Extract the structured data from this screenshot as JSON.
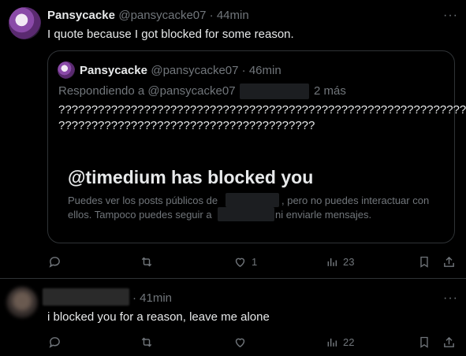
{
  "main_tweet": {
    "display_name": "Pansycacke",
    "handle_time": "@pansycacke07 · 44min",
    "text": "I quote because I got blocked for some reason.",
    "quote": {
      "display_name": "Pansycacke",
      "handle_time": "@pansycacke07 · 46min",
      "replying_prefix": "Respondiendo a @pansycacke07",
      "replying_suffix": "2 más",
      "text_line1": "???????????????????????????????????????????????????????????????",
      "text_line2": "???????????????????????????????????????",
      "blocked_title": "@timedium has blocked you",
      "blocked_desc_part1": "Puedes ver los posts públicos de",
      "blocked_desc_part2": ", pero no puedes interactuar con",
      "blocked_desc_part3": "ellos. Tampoco puedes seguir a",
      "blocked_desc_part4": "ni enviarle mensajes."
    },
    "actions": {
      "likes": "1",
      "views": "23"
    }
  },
  "reply_tweet": {
    "time": "· 41min",
    "text": "i blocked you for a reason, leave me alone",
    "actions": {
      "views": "22"
    }
  },
  "icons": [
    "more-icon",
    "reply-icon",
    "retweet-icon",
    "like-icon",
    "views-icon",
    "bookmark-icon",
    "share-icon"
  ],
  "colors": {
    "background": "#000000",
    "text": "#e7e9ea",
    "muted": "#71767b",
    "border": "#2f3336"
  }
}
